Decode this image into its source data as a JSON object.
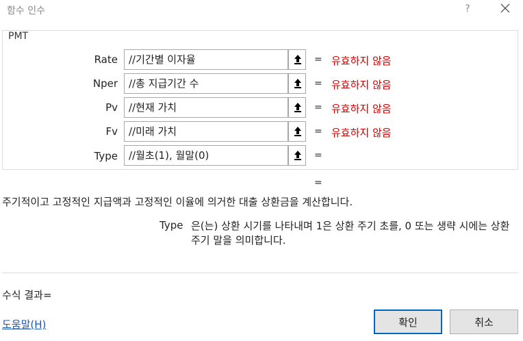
{
  "window": {
    "title": "함수 인수",
    "help_label": "?",
    "close_icon": "close-icon"
  },
  "group_title": "PMT",
  "arguments": [
    {
      "label": "Rate",
      "value": "//기간별 이자율",
      "eq": "=",
      "result": "유효하지 않음"
    },
    {
      "label": "Nper",
      "value": "//총 지급기간 수",
      "eq": "=",
      "result": "유효하지 않음"
    },
    {
      "label": "Pv",
      "value": "//현재 가치",
      "eq": "=",
      "result": "유효하지 않음"
    },
    {
      "label": "Fv",
      "value": "//미래 가치",
      "eq": "=",
      "result": "유효하지 않음"
    },
    {
      "label": "Type",
      "value": "//월초(1), 월말(0)",
      "eq": "=",
      "result": ""
    }
  ],
  "function_result_eq": "=",
  "description": "주기적이고 고정적인 지급액과 고정적인 이율에 의거한 대출 상환금을 계산합니다.",
  "argument_help": {
    "name": "Type",
    "text": "은(는) 상환 시기를 나타내며 1은 상환 주기 초를, 0 또는 생략 시에는 상환 주기 말을 의미합니다."
  },
  "formula_result_label": "수식 결과=",
  "help_link": "도움말(H)",
  "buttons": {
    "ok": "확인",
    "cancel": "취소"
  },
  "colors": {
    "invalid": "#d10000",
    "link": "#1a55b7",
    "default_button_border": "#0067c0"
  }
}
